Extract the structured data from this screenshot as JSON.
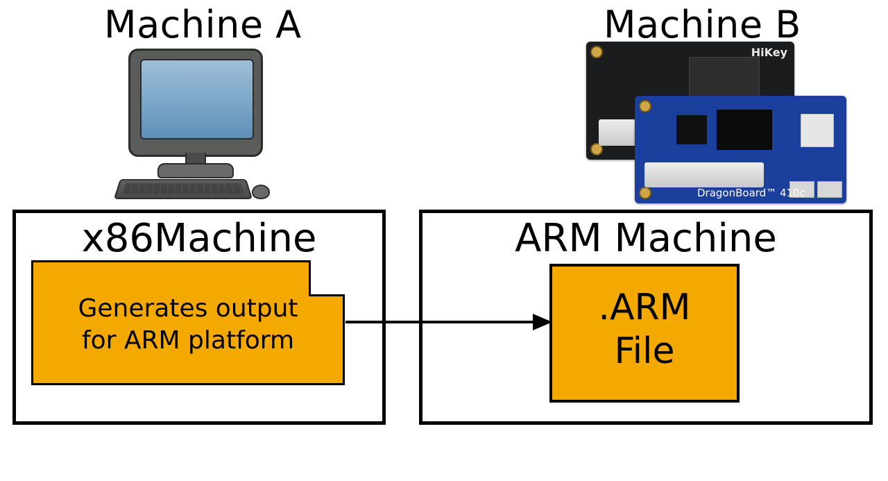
{
  "titles": {
    "machine_a": "Machine A",
    "machine_b": "Machine B"
  },
  "boards": {
    "hikey_label": "HiKey",
    "dragon_label": "DragonBoard™ 410c"
  },
  "boxes": {
    "left_title": "x86Machine",
    "right_title": "ARM Machine"
  },
  "note": {
    "line1": "Generates output",
    "line2": "for ARM platform"
  },
  "file": {
    "line1": ".ARM",
    "line2": "File"
  },
  "colors": {
    "highlight": "#f4a900",
    "board_blue": "#1b3f9c",
    "board_black": "#1b1c1d"
  }
}
